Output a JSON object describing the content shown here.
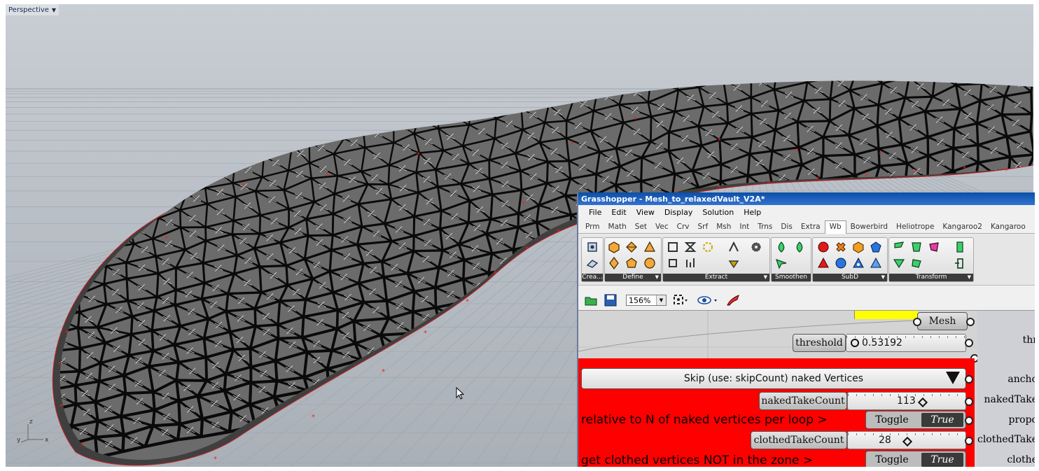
{
  "viewport": {
    "label": "Perspective"
  },
  "axes": {
    "x": "x",
    "y": "y",
    "z": "z"
  },
  "grasshopper": {
    "title": "Grasshopper - Mesh_to_relaxedVault_V2A*",
    "menu": [
      "File",
      "Edit",
      "View",
      "Display",
      "Solution",
      "Help"
    ],
    "tabs": [
      "Prm",
      "Math",
      "Set",
      "Vec",
      "Crv",
      "Srf",
      "Msh",
      "Int",
      "Trns",
      "Dis",
      "Extra",
      "Wb",
      "Bowerbird",
      "Heliotrope",
      "Kangaroo2",
      "Kangaroo"
    ],
    "active_tab": "Wb",
    "ribbon_groups": [
      "Crea...",
      "Define",
      "Extract",
      "Smoothen",
      "SubD",
      "Transform"
    ],
    "zoom": "156%",
    "canvas": {
      "mesh_label": "Mesh",
      "threshold_label": "threshold",
      "threshold_value": "0.53192",
      "dropdown_label": "Skip (use: skipCount) naked Vertices",
      "naked_take_label": "nakedTakeCount",
      "naked_take_value": "113",
      "relative_text": "relative to N of naked vertices per loop >",
      "toggle_label": "Toggle",
      "toggle_value": "True",
      "clothed_take_label": "clothedTakeCount",
      "clothed_take_value": "28",
      "clothed_text": "get clothed vertices NOT in the zone >",
      "toggle2_label": "Toggle",
      "toggle2_value": "True"
    },
    "side_labels": [
      "thr",
      "ancho",
      "nakedTake",
      "propo",
      "clothedTake",
      "clothe"
    ]
  },
  "colors": {
    "accent_red": "#ff0000",
    "title_blue": "#0a4fa8",
    "highlight_yellow": "#ffff00"
  }
}
